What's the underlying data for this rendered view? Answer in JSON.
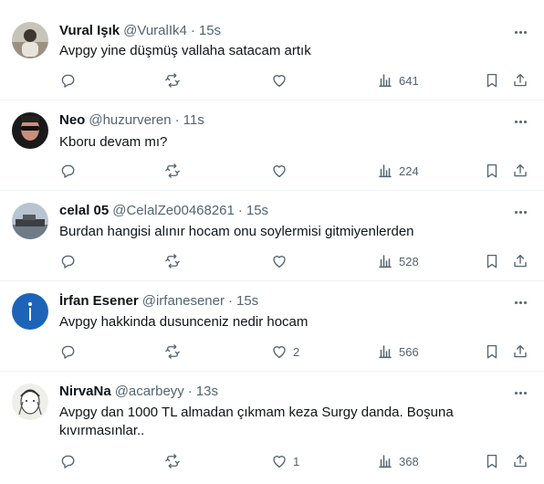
{
  "tweets": [
    {
      "name": "Vural Işık",
      "handle": "@VuralIk4",
      "sep": "·",
      "time": "15s",
      "text": "Avpgy yine düşmüş vallaha satacam artık",
      "likes": "",
      "views": "641",
      "avatar_icon": "avatar-person-photo"
    },
    {
      "name": "Neo",
      "handle": "@huzurveren",
      "sep": "·",
      "time": "11s",
      "text": "Kboru devam mı?",
      "likes": "",
      "views": "224",
      "avatar_icon": "avatar-sunglasses-photo"
    },
    {
      "name": "celal 05",
      "handle": "@CelalZe00468261",
      "sep": "·",
      "time": "15s",
      "text": "Burdan hangisi alınır hocam onu soylermisi  gitmiyenlerden",
      "likes": "",
      "views": "528",
      "avatar_icon": "avatar-ship-photo"
    },
    {
      "name": "İrfan Esener",
      "handle": "@irfanesener",
      "sep": "·",
      "time": "15s",
      "text": "Avpgy hakkinda dusunceniz nedir hocam",
      "likes": "2",
      "views": "566",
      "avatar_icon": "avatar-letter-i"
    },
    {
      "name": "NirvaNa",
      "handle": "@acarbeyy",
      "sep": "·",
      "time": "13s",
      "text": "Avpgy dan 1000 TL almadan çıkmam keza Surgy danda. Boşuna kıvırmasınlar..",
      "likes": "1",
      "views": "368",
      "avatar_icon": "avatar-sketch-portrait"
    }
  ],
  "colors": {
    "text": "#0f1419",
    "secondary": "#536471",
    "divider": "#eff3f4",
    "avatar_blue": "#1d64b8"
  },
  "icons": [
    "reply-icon",
    "retweet-icon",
    "like-icon",
    "views-icon",
    "bookmark-icon",
    "share-icon",
    "more-icon"
  ]
}
